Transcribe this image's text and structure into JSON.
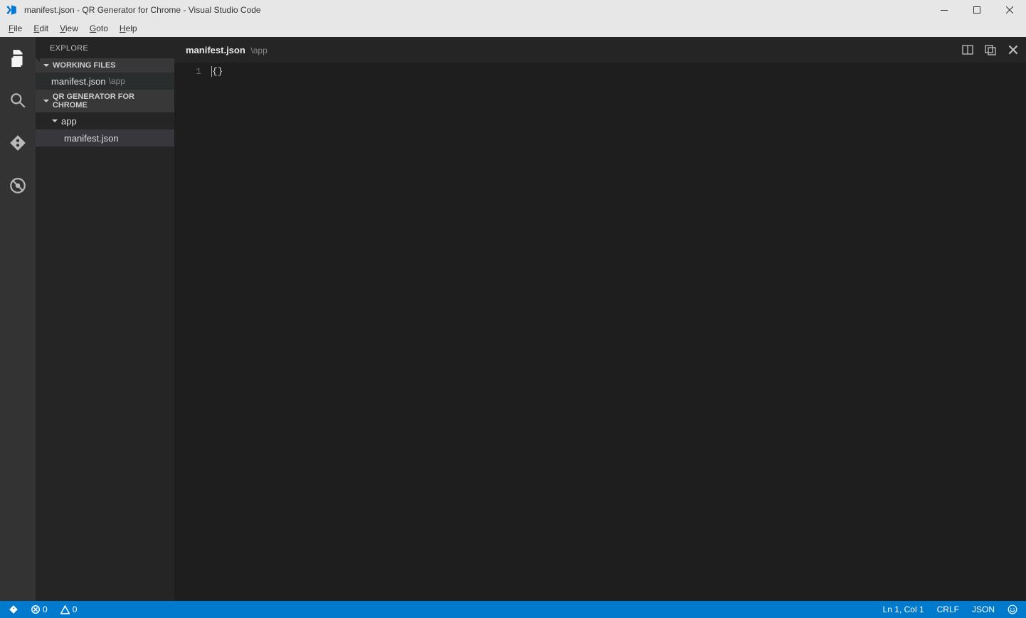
{
  "window": {
    "title": "manifest.json - QR Generator for Chrome - Visual Studio Code"
  },
  "menu": {
    "items": [
      "File",
      "Edit",
      "View",
      "Goto",
      "Help"
    ]
  },
  "activity": {
    "active": "explorer"
  },
  "sidebar": {
    "title": "EXPLORE",
    "working_files_label": "WORKING FILES",
    "project_label": "QR GENERATOR FOR CHROME",
    "working_files": [
      {
        "name": "manifest.json",
        "hint": "\\app"
      }
    ],
    "tree": {
      "folder": "app",
      "files": [
        {
          "name": "manifest.json"
        }
      ]
    }
  },
  "tab": {
    "name": "manifest.json",
    "hint": "\\app"
  },
  "editor": {
    "lines": [
      {
        "num": "1",
        "text": "{}"
      }
    ]
  },
  "status": {
    "git_icon": "git",
    "errors": "0",
    "warnings": "0",
    "position": "Ln 1, Col 1",
    "eol": "CRLF",
    "language": "JSON"
  }
}
